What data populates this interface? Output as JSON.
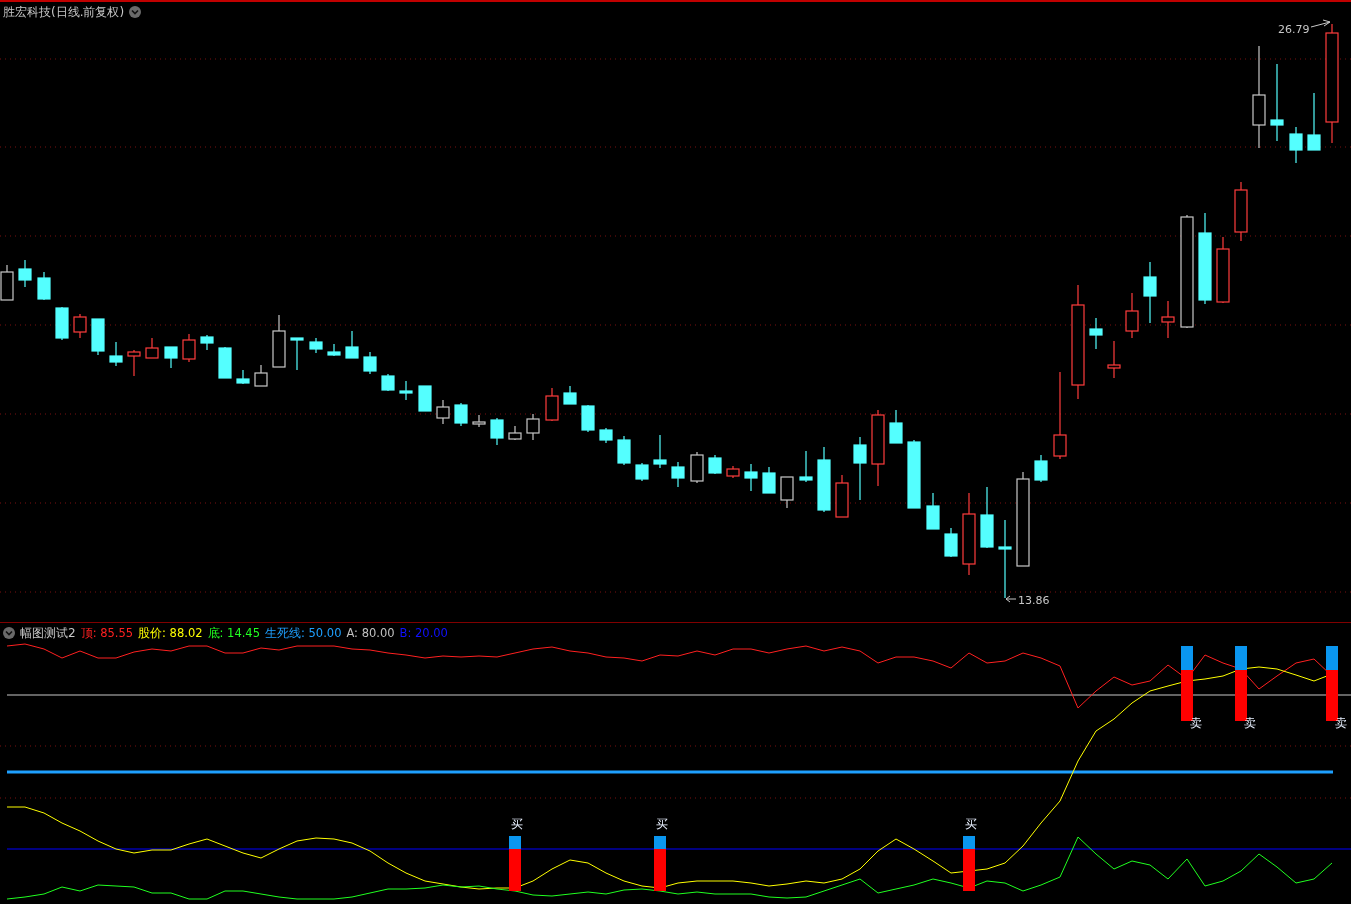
{
  "main_panel": {
    "title": "胜宏科技(日线.前复权)",
    "high_label": "26.79",
    "low_label": "13.86"
  },
  "indicator_panel": {
    "name": "幅图测试2",
    "values": [
      {
        "text": "顶: 85.55",
        "color": "#ff2020"
      },
      {
        "text": "股价: 88.02",
        "color": "#ffff00"
      },
      {
        "text": "底: 14.45",
        "color": "#20ff20"
      },
      {
        "text": "生死线: 50.00",
        "color": "#1ea0ff"
      },
      {
        "text": "A: 80.00",
        "color": "#c0c0c0"
      },
      {
        "text": "B: 20.00",
        "color": "#1010ff"
      }
    ],
    "signals": [
      {
        "kind": "buy",
        "label": "买"
      },
      {
        "kind": "buy",
        "label": "买"
      },
      {
        "kind": "buy",
        "label": "买"
      },
      {
        "kind": "sell",
        "label": "卖"
      },
      {
        "kind": "sell",
        "label": "卖"
      },
      {
        "kind": "sell",
        "label": "卖"
      }
    ]
  }
}
